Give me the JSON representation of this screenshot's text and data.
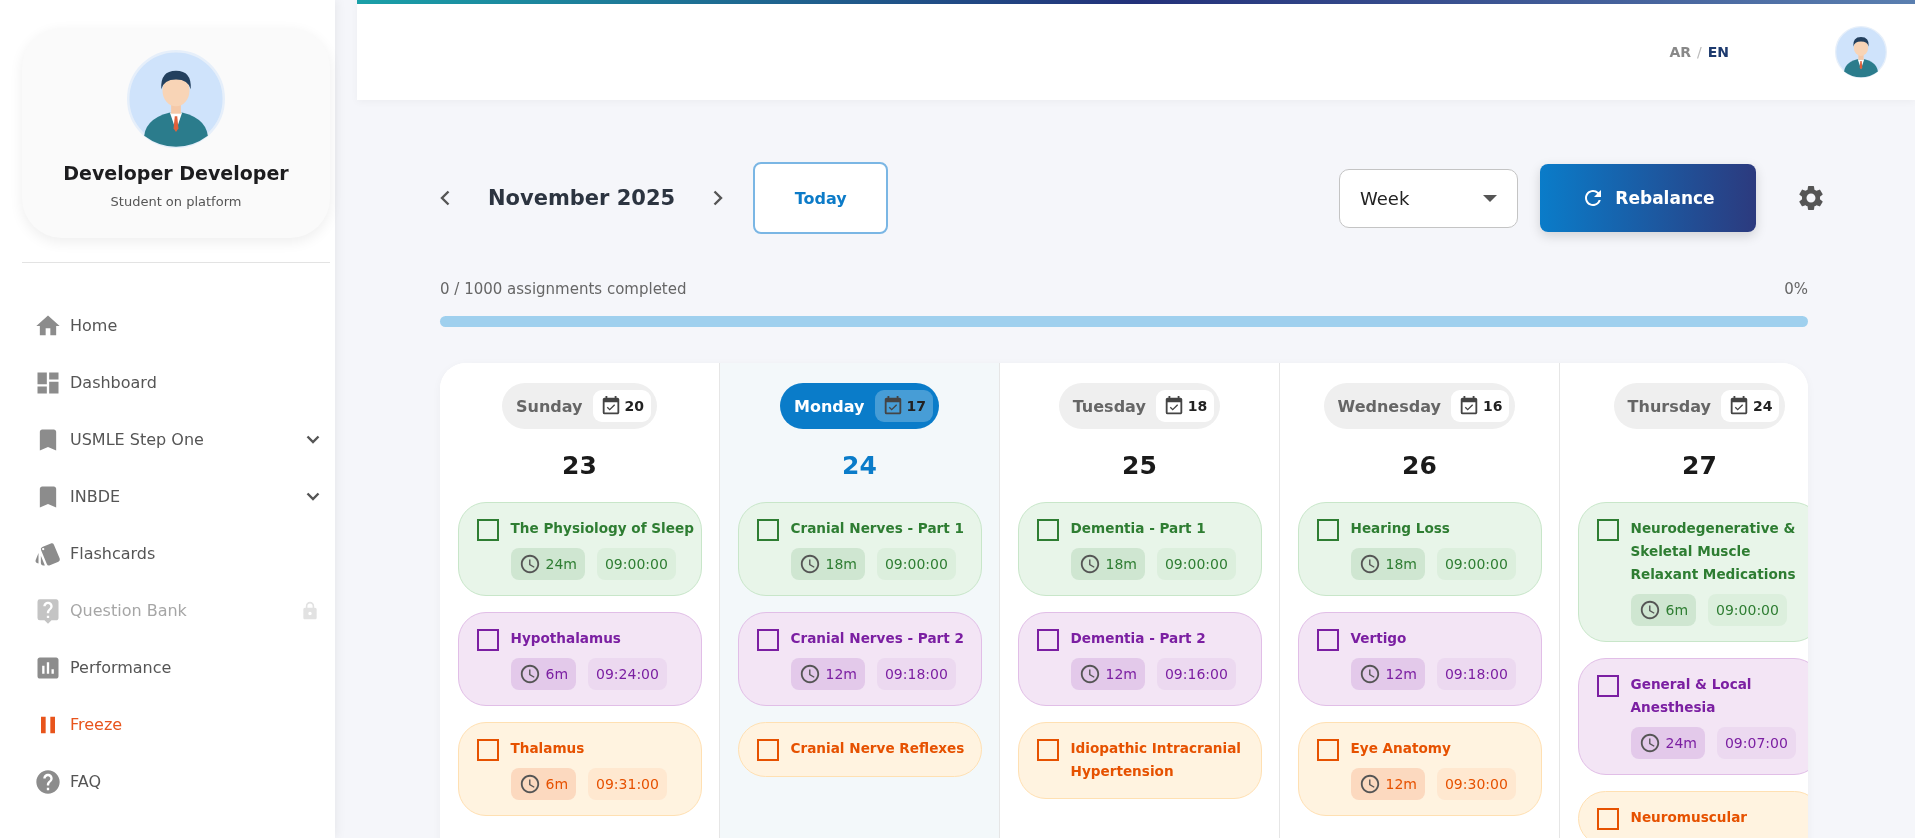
{
  "sidebar": {
    "profile": {
      "name": "Developer Developer",
      "role": "Student on platform"
    },
    "items": [
      {
        "label": "Home",
        "selected": false,
        "expandable": false,
        "disabled": false,
        "locked": false
      },
      {
        "label": "Dashboard",
        "selected": false,
        "expandable": false,
        "disabled": false,
        "locked": false
      },
      {
        "label": "USMLE Step One",
        "selected": false,
        "expandable": true,
        "disabled": false,
        "locked": false
      },
      {
        "label": "INBDE",
        "selected": false,
        "expandable": true,
        "disabled": false,
        "locked": false
      },
      {
        "label": "Flashcards",
        "selected": false,
        "expandable": false,
        "disabled": false,
        "locked": false
      },
      {
        "label": "Question Bank",
        "selected": false,
        "expandable": false,
        "disabled": true,
        "locked": true
      },
      {
        "label": "Performance",
        "selected": false,
        "expandable": false,
        "disabled": false,
        "locked": false
      },
      {
        "label": "Freeze",
        "selected": true,
        "expandable": false,
        "disabled": false,
        "locked": false
      },
      {
        "label": "FAQ",
        "selected": false,
        "expandable": false,
        "disabled": false,
        "locked": false
      }
    ]
  },
  "header": {
    "languages": [
      {
        "label": "AR",
        "selected": false
      },
      {
        "label": "EN",
        "selected": true
      }
    ],
    "separator": "/"
  },
  "toolbar": {
    "month": "November 2025",
    "today": "Today",
    "view": "Week",
    "rebalance": "Rebalance"
  },
  "progress": {
    "text": "0 / 1000 assignments completed",
    "percent": "0%",
    "level": 0
  },
  "days": [
    {
      "name": "Sunday",
      "count": "20",
      "date": "23",
      "selected": false,
      "tasks": [
        {
          "title": "The Physiology of Sleep",
          "color": "#2e7d32",
          "checked": false,
          "duration": "24m",
          "time": "09:00:00"
        },
        {
          "title": "Hypothalamus",
          "color": "#7b1fa2",
          "checked": false,
          "duration": "6m",
          "time": "09:24:00"
        },
        {
          "title": "Thalamus",
          "color": "#e65100",
          "checked": false,
          "duration": "6m",
          "time": "09:31:00"
        }
      ]
    },
    {
      "name": "Monday",
      "count": "17",
      "date": "24",
      "selected": true,
      "tasks": [
        {
          "title": "Cranial Nerves - Part 1",
          "color": "#2e7d32",
          "checked": false,
          "duration": "18m",
          "time": "09:00:00"
        },
        {
          "title": "Cranial Nerves - Part 2",
          "color": "#7b1fa2",
          "checked": false,
          "duration": "12m",
          "time": "09:18:00"
        },
        {
          "title": "Cranial Nerve Reflexes",
          "color": "#e65100",
          "checked": false
        }
      ]
    },
    {
      "name": "Tuesday",
      "count": "18",
      "date": "25",
      "selected": false,
      "tasks": [
        {
          "title": "Dementia - Part 1",
          "color": "#2e7d32",
          "checked": false,
          "duration": "18m",
          "time": "09:00:00"
        },
        {
          "title": "Dementia - Part 2",
          "color": "#7b1fa2",
          "checked": false,
          "duration": "12m",
          "time": "09:16:00"
        },
        {
          "title": "Idiopathic Intracranial Hypertension",
          "color": "#e65100",
          "checked": false
        }
      ]
    },
    {
      "name": "Wednesday",
      "count": "16",
      "date": "26",
      "selected": false,
      "tasks": [
        {
          "title": "Hearing Loss",
          "color": "#2e7d32",
          "checked": false,
          "duration": "18m",
          "time": "09:00:00"
        },
        {
          "title": "Vertigo",
          "color": "#7b1fa2",
          "checked": false,
          "duration": "12m",
          "time": "09:18:00"
        },
        {
          "title": "Eye Anatomy",
          "color": "#e65100",
          "checked": false,
          "duration": "12m",
          "time": "09:30:00"
        }
      ]
    },
    {
      "name": "Thursday",
      "count": "24",
      "date": "27",
      "selected": false,
      "tasks": [
        {
          "title": "Neurodegenerative & Skeletal Muscle Relaxant Medications",
          "color": "#2e7d32",
          "checked": false,
          "duration": "6m",
          "time": "09:00:00"
        },
        {
          "title": "General & Local Anesthesia",
          "color": "#7b1fa2",
          "checked": false,
          "duration": "24m",
          "time": "09:07:00"
        },
        {
          "title": "Neuromuscular",
          "color": "#e65100",
          "checked": false
        }
      ]
    }
  ]
}
